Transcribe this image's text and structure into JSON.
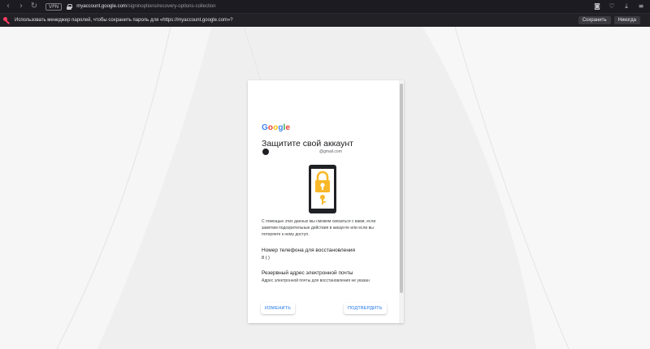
{
  "browser": {
    "vpn_label": "VPN",
    "url_host": "myaccount.google.com",
    "url_path": "/signinoptions/recovery-options-collection"
  },
  "infobar": {
    "text": "Использовать менеджер паролей, чтобы сохранить пароль для «https://myaccount.google.com»?",
    "save_label": "Сохранить",
    "never_label": "Никогда"
  },
  "card": {
    "logo_letters": [
      "G",
      "o",
      "o",
      "g",
      "l",
      "e"
    ],
    "title": "Защитите свой аккаунт",
    "email": "@gmail.com",
    "description": "С помощью этих данных мы сможем связаться с вами, если заметим подозрительные действия в аккаунте или если вы потеряете к нему доступ.",
    "phone_section_title": "Номер телефона для восстановления",
    "phone_value": "8 (   )",
    "email_section_title": "Резервный адрес электронной почты",
    "email_value": "Адрес электронной почты для восстановления не указан",
    "change_button": "ИЗМЕНИТЬ",
    "confirm_button": "ПОДТВЕРДИТЬ"
  },
  "colors": {
    "accent": "#1a73e8",
    "infobar_key": "#ff3d62",
    "lock_yellow": "#f9b829"
  },
  "icons": {
    "back": "back-arrow-icon",
    "forward": "forward-arrow-icon",
    "reload": "reload-icon",
    "lock": "lock-icon",
    "key": "key-icon",
    "camera": "camera-icon",
    "bookmark": "bookmark-icon",
    "download": "download-icon",
    "menu": "menu-icon"
  }
}
